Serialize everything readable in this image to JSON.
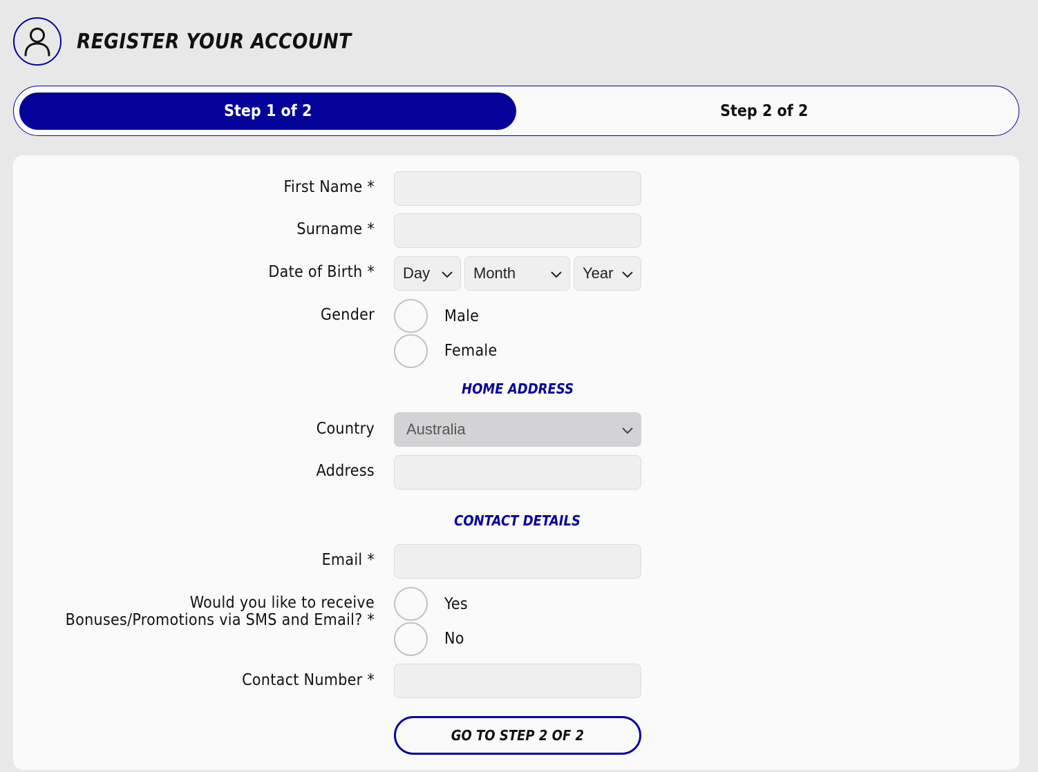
{
  "header": {
    "title": "REGISTER YOUR ACCOUNT",
    "icon": "user-icon"
  },
  "steps": [
    {
      "label": "Step 1 of 2",
      "active": true
    },
    {
      "label": "Step 2 of 2",
      "active": false
    }
  ],
  "colors": {
    "accent": "#03039a",
    "background": "#e8e8e8",
    "card": "#fafafa",
    "input": "#efefef",
    "disabled_select": "#d3d3d5"
  },
  "form": {
    "first_name": {
      "label": "First Name *",
      "value": ""
    },
    "surname": {
      "label": "Surname *",
      "value": ""
    },
    "dob": {
      "label": "Date of Birth *",
      "day": "Day",
      "month": "Month",
      "year": "Year"
    },
    "gender": {
      "label": "Gender",
      "options": [
        "Male",
        "Female"
      ],
      "selected": null
    },
    "home_address_heading": "HOME ADDRESS",
    "country": {
      "label": "Country",
      "value": "Australia"
    },
    "address": {
      "label": "Address",
      "value": ""
    },
    "contact_details_heading": "CONTACT DETAILS",
    "email": {
      "label": "Email *",
      "value": ""
    },
    "promotions": {
      "label_line1": "Would you like to receive",
      "label_line2": "Bonuses/Promotions via SMS and Email? *",
      "options": [
        "Yes",
        "No"
      ],
      "selected": null
    },
    "contact_number": {
      "label": "Contact Number *",
      "value": ""
    },
    "submit_label": "GO TO STEP 2 OF 2"
  }
}
